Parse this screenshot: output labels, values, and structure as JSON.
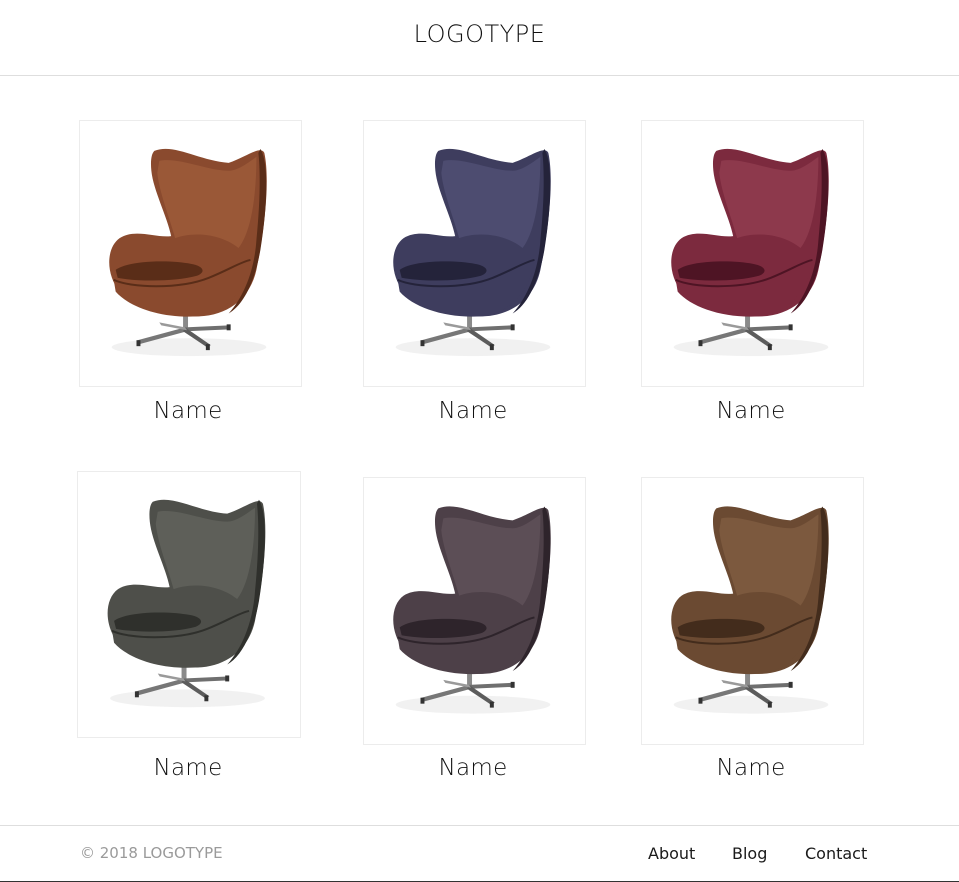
{
  "header": {
    "logo": "LOGOTYPE"
  },
  "products": [
    {
      "name": "Name",
      "color": "#8a4a2e",
      "shade": "#5a2d18",
      "highlight": "#a8653f",
      "icon": "egg-chair-icon"
    },
    {
      "name": "Name",
      "color": "#3e3d5e",
      "shade": "#24233a",
      "highlight": "#5a5a80",
      "icon": "egg-chair-icon"
    },
    {
      "name": "Name",
      "color": "#7c2a3e",
      "shade": "#4e1424",
      "highlight": "#9a4558",
      "icon": "egg-chair-icon"
    },
    {
      "name": "Name",
      "color": "#4e4f4a",
      "shade": "#2f302c",
      "highlight": "#6c6d66",
      "icon": "egg-chair-icon"
    },
    {
      "name": "Name",
      "color": "#4d4048",
      "shade": "#2e242b",
      "highlight": "#6a5a63",
      "icon": "egg-chair-icon"
    },
    {
      "name": "Name",
      "color": "#6b4a32",
      "shade": "#432c1c",
      "highlight": "#8a6648",
      "icon": "egg-chair-icon"
    }
  ],
  "footer": {
    "copyright": "© 2018 LOGOTYPE",
    "links": [
      "About",
      "Blog",
      "Contact"
    ]
  }
}
